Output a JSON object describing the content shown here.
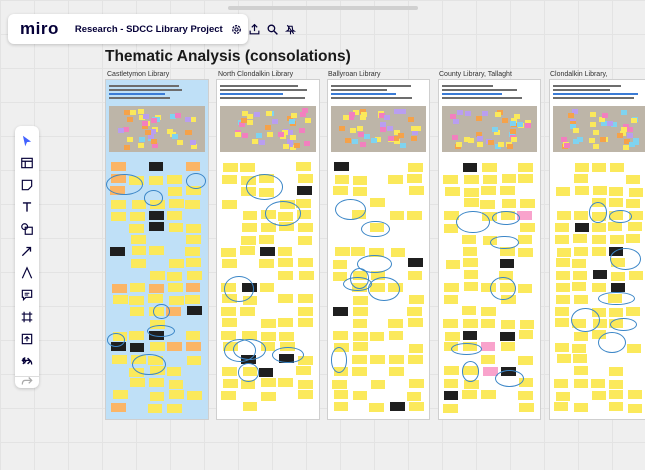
{
  "app": {
    "logo": "miro",
    "board_name": "Research - SDCC Library Project"
  },
  "toolbar_top": {
    "icons": [
      "settings-icon",
      "share-icon",
      "search-icon",
      "hide-icon"
    ]
  },
  "frame": {
    "title": "Thematic Analysis  (consolations)"
  },
  "columns": [
    {
      "label": "Castletymon Library"
    },
    {
      "label": "North Clondalkin Library"
    },
    {
      "label": "Ballyroan Library"
    },
    {
      "label": "County Library, Tallaght"
    },
    {
      "label": "Clondalkin Library,"
    }
  ],
  "left_toolbar": {
    "tools": [
      "select-icon",
      "templates-icon",
      "sticky-note-icon",
      "text-icon",
      "shapes-icon",
      "connector-icon",
      "pen-icon",
      "comment-icon",
      "frame-icon",
      "upload-icon",
      "more-icon",
      "undo-icon",
      "redo-icon"
    ]
  }
}
